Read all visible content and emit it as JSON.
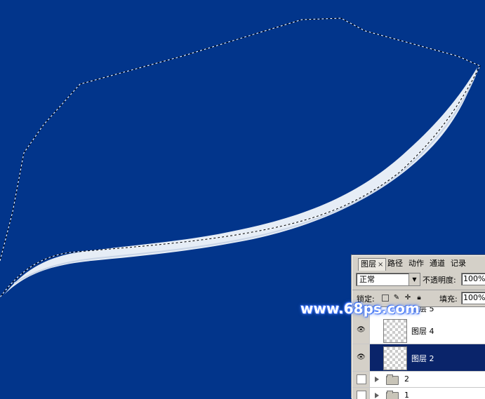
{
  "canvas": {
    "background_color": "#02358b",
    "shape_fill": "#e6edf6",
    "selection_style": "marching-ants"
  },
  "watermark": {
    "text": "www.68ps.com"
  },
  "layers_panel": {
    "tabs": [
      {
        "label": "图层",
        "active": true,
        "close": "×"
      },
      {
        "label": "路径",
        "active": false
      },
      {
        "label": "动作",
        "active": false
      },
      {
        "label": "通道",
        "active": false
      },
      {
        "label": "记录",
        "active": false
      }
    ],
    "blend_mode": "正常",
    "opacity_label": "不透明度:",
    "opacity_value": "100%",
    "lock_label": "锁定:",
    "fill_label": "填充:",
    "fill_value": "100%",
    "layers": [
      {
        "name": "图层 5",
        "visible": false,
        "selected": false,
        "partial": true
      },
      {
        "name": "图层 4",
        "visible": true,
        "selected": false
      },
      {
        "name": "图层 2",
        "visible": true,
        "selected": true
      },
      {
        "name": "2",
        "type": "group",
        "visible": false
      },
      {
        "name": "1",
        "type": "group",
        "visible": false,
        "partial": true
      }
    ]
  }
}
